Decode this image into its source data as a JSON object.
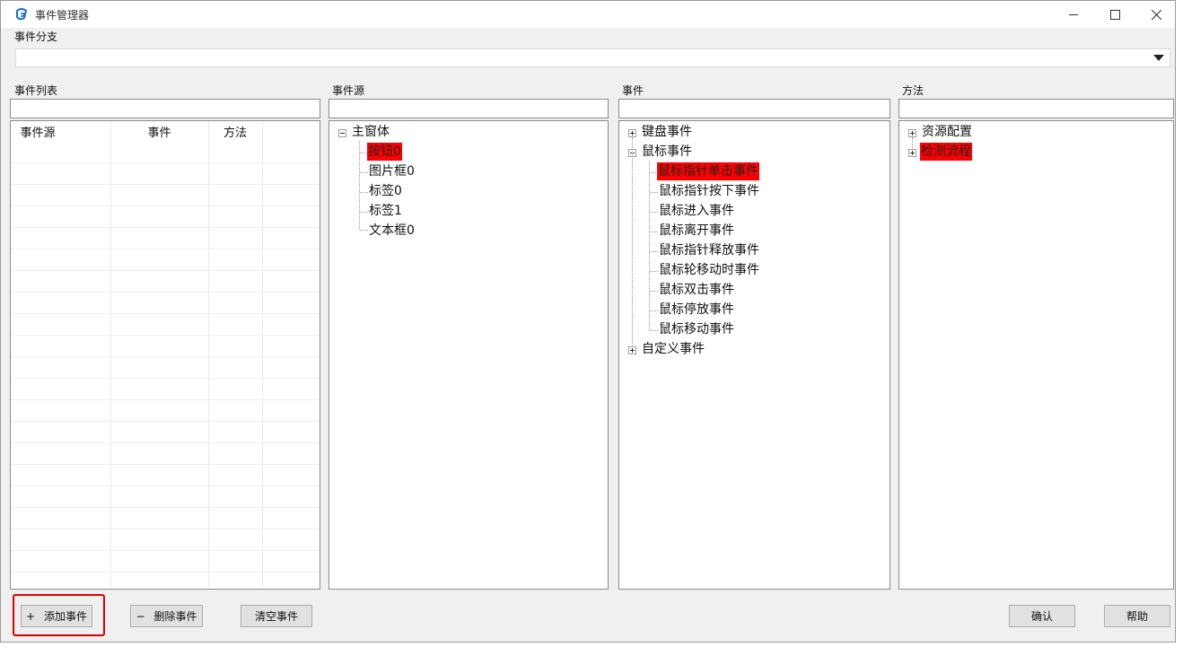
{
  "window": {
    "title": "事件管理器"
  },
  "branch": {
    "label": "事件分支",
    "value": ""
  },
  "panels": {
    "event_list": {
      "label": "事件列表",
      "columns": [
        "事件源",
        "事件",
        "方法"
      ]
    },
    "source": {
      "label": "事件源",
      "root": "主窗体",
      "children": [
        "按钮0",
        "图片框0",
        "标签0",
        "标签1",
        "文本框0"
      ]
    },
    "events": {
      "label": "事件",
      "groups": [
        "键盘事件",
        "鼠标事件",
        "自定义事件"
      ],
      "mouse_children": [
        "鼠标指针单击事件",
        "鼠标指针按下事件",
        "鼠标进入事件",
        "鼠标离开事件",
        "鼠标指针释放事件",
        "鼠标轮移动时事件",
        "鼠标双击事件",
        "鼠标停放事件",
        "鼠标移动事件"
      ]
    },
    "methods": {
      "label": "方法",
      "items": [
        "资源配置",
        "检测流程"
      ]
    }
  },
  "buttons": {
    "add": "添加事件",
    "add_prefix": "+",
    "delete": "删除事件",
    "delete_prefix": "−",
    "clear": "清空事件",
    "confirm": "确认",
    "help": "帮助"
  },
  "colors": {
    "selection": "#ff0000",
    "highlight_frame": "#e00000"
  }
}
